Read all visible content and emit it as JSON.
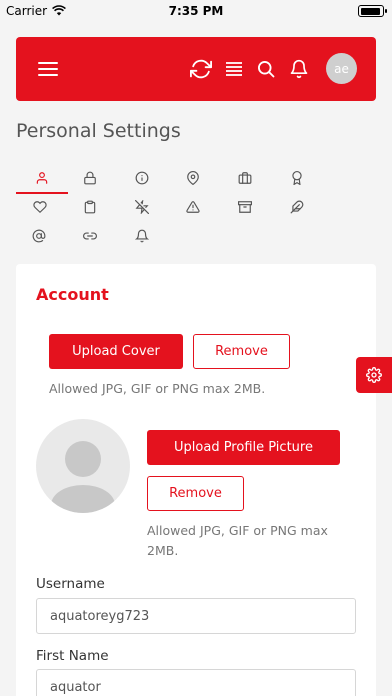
{
  "status_bar": {
    "carrier": "Carrier",
    "time": "7:35 PM"
  },
  "header": {
    "avatar_initials": "ae",
    "icons": [
      "hamburger-icon",
      "refresh-icon",
      "list-icon",
      "search-icon",
      "bell-icon"
    ],
    "color": "#e4121e"
  },
  "page_title": "Personal Settings",
  "tabs": [
    {
      "icon": "user-icon",
      "active": true
    },
    {
      "icon": "lock-icon"
    },
    {
      "icon": "info-icon"
    },
    {
      "icon": "location-icon"
    },
    {
      "icon": "briefcase-icon"
    },
    {
      "icon": "award-icon"
    },
    {
      "icon": "heart-icon"
    },
    {
      "icon": "clipboard-icon"
    },
    {
      "icon": "zap-off-icon"
    },
    {
      "icon": "alert-icon"
    },
    {
      "icon": "archive-icon"
    },
    {
      "icon": "feather-icon"
    },
    {
      "icon": "at-icon"
    },
    {
      "icon": "link-icon"
    },
    {
      "icon": "bell-icon"
    }
  ],
  "account": {
    "title": "Account",
    "upload_cover": "Upload Cover",
    "remove_cover": "Remove",
    "cover_hint": "Allowed JPG, GIF or PNG max 2MB.",
    "upload_profile": "Upload Profile Picture",
    "remove_profile": "Remove",
    "profile_hint_line1": "Allowed JPG, GIF or PNG max",
    "profile_hint_line2": "2MB.",
    "username_label": "Username",
    "username_value": "aquatoreyg723",
    "firstname_label": "First Name",
    "firstname_value": "aquator"
  }
}
